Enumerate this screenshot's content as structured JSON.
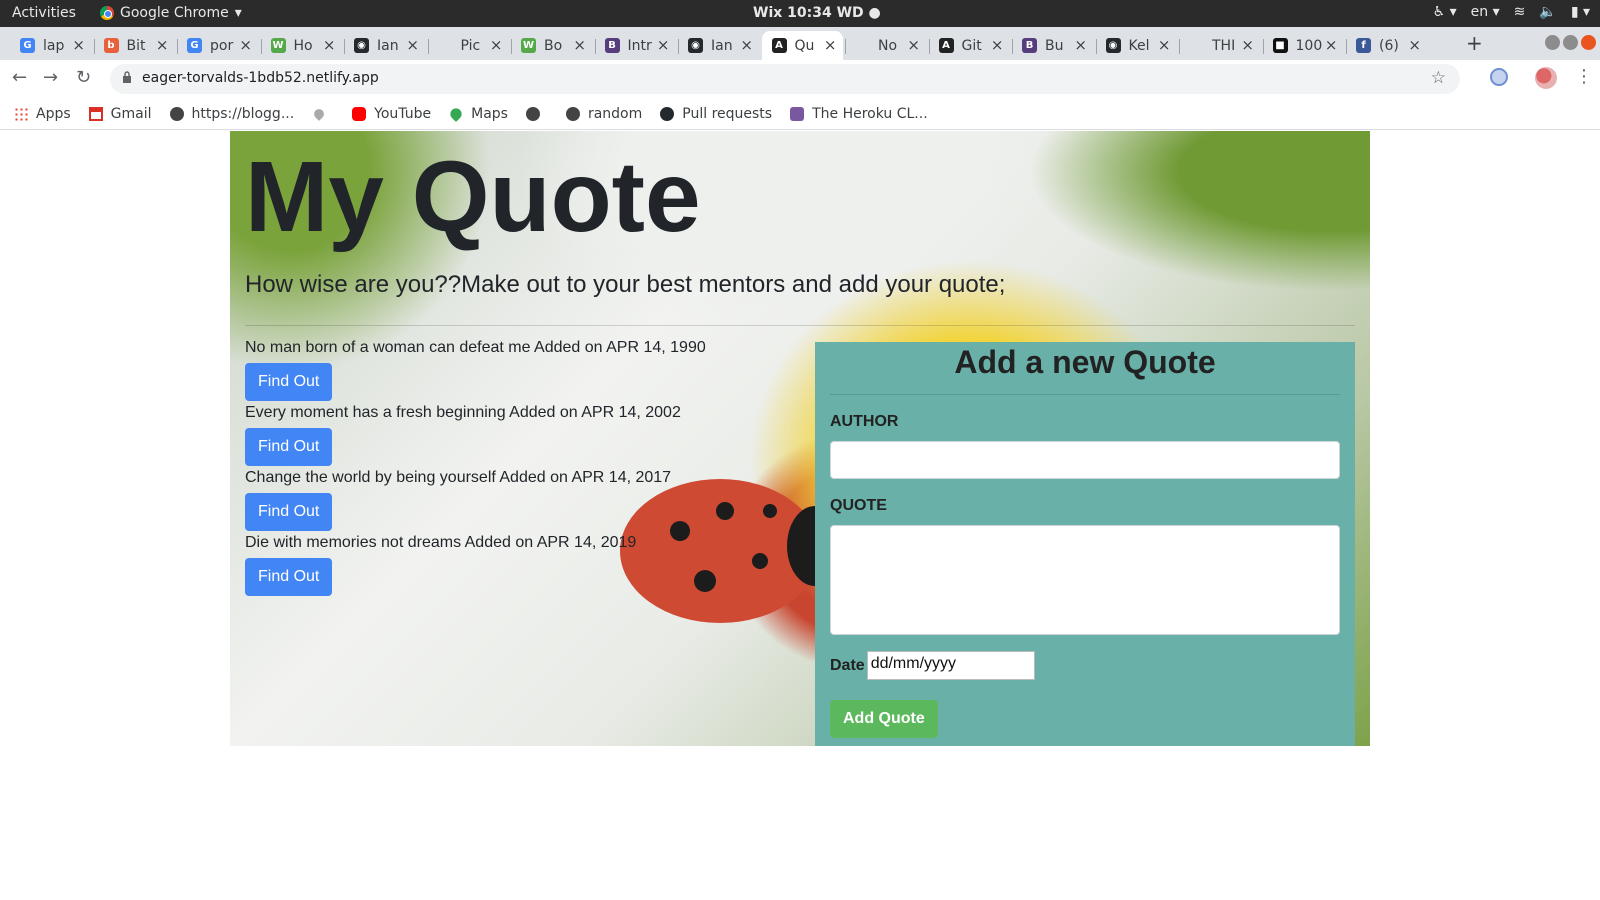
{
  "os_bar": {
    "activities": "Activities",
    "app_name": "Google Chrome",
    "clock": "Wix 10:34 WD",
    "lang": "en"
  },
  "tabs": [
    {
      "title": "lap",
      "fav_color": "#4285f4",
      "fav_char": "G"
    },
    {
      "title": "Bit",
      "fav_color": "#e8603c",
      "fav_char": "b"
    },
    {
      "title": "por",
      "fav_color": "#4285f4",
      "fav_char": "G"
    },
    {
      "title": "Ho",
      "fav_color": "#56a94a",
      "fav_char": "W"
    },
    {
      "title": "Ian",
      "fav_color": "#24292e",
      "fav_char": "◉"
    },
    {
      "title": "Pic",
      "fav_color": "#dee1e6",
      "fav_char": ""
    },
    {
      "title": "Bo",
      "fav_color": "#56a94a",
      "fav_char": "W"
    },
    {
      "title": "Intr",
      "fav_color": "#563d7c",
      "fav_char": "B"
    },
    {
      "title": "Ian",
      "fav_color": "#24292e",
      "fav_char": "◉"
    },
    {
      "title": "Qu",
      "fav_color": "#222222",
      "fav_char": "A",
      "active": true
    },
    {
      "title": "No",
      "fav_color": "#dee1e6",
      "fav_char": ""
    },
    {
      "title": "Git",
      "fav_color": "#222222",
      "fav_char": "A"
    },
    {
      "title": "Bu",
      "fav_color": "#563d7c",
      "fav_char": "B"
    },
    {
      "title": "Kel",
      "fav_color": "#24292e",
      "fav_char": "◉"
    },
    {
      "title": "THI",
      "fav_color": "#dee1e6",
      "fav_char": ""
    },
    {
      "title": "100",
      "fav_color": "#111111",
      "fav_char": "■"
    },
    {
      "title": "(6)",
      "fav_color": "#3b5998",
      "fav_char": "f"
    }
  ],
  "address_bar": {
    "url": "eager-torvalds-1bdb52.netlify.app"
  },
  "bookmarks": [
    {
      "label": "Apps",
      "icon": "apps-grid-icon"
    },
    {
      "label": "Gmail",
      "icon": "gmail-icon"
    },
    {
      "label": "https://blogg...",
      "icon": "globe-icon"
    },
    {
      "label": "",
      "icon": "pin-icon"
    },
    {
      "label": "YouTube",
      "icon": "youtube-icon"
    },
    {
      "label": "Maps",
      "icon": "maps-icon"
    },
    {
      "label": "",
      "icon": "globe-icon"
    },
    {
      "label": "random",
      "icon": "globe-icon"
    },
    {
      "label": "Pull requests",
      "icon": "github-icon"
    },
    {
      "label": "The Heroku CL...",
      "icon": "heroku-icon"
    }
  ],
  "page": {
    "title": "My Quote",
    "subtitle": "How wise are you??Make out to your best mentors and add your quote;",
    "quotes": [
      {
        "text": "No man born of a woman can defeat me Added on APR 14, 1990",
        "button": "Find Out"
      },
      {
        "text": "Every moment has a fresh beginning Added on APR 14, 2002",
        "button": "Find Out"
      },
      {
        "text": "Change the world by being yourself Added on APR 14, 2017",
        "button": "Find Out"
      },
      {
        "text": "Die with memories not dreams Added on APR 14, 2019",
        "button": "Find Out"
      }
    ],
    "form": {
      "heading": "Add a new Quote",
      "author_label": "AUTHOR",
      "author_value": "",
      "quote_label": "QUOTE",
      "quote_value": "",
      "date_label": "Date",
      "date_placeholder": "dd/mm/yyyy",
      "submit": "Add Quote"
    }
  },
  "colors": {
    "find_button": "#4285f4",
    "form_panel": "#68b0a8",
    "submit_button": "#5cb85c"
  }
}
